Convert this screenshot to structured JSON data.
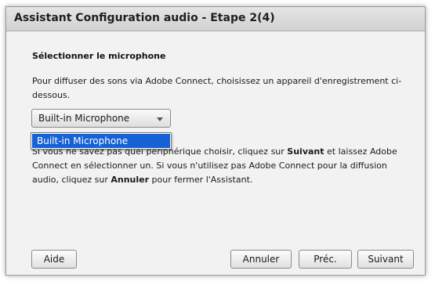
{
  "window": {
    "title": "Assistant Configuration audio - Etape 2(4)"
  },
  "content": {
    "heading": "Sélectionner le microphone",
    "description": "Pour diffuser des sons via Adobe Connect, choisissez un appareil d'enregistrement ci-dessous.",
    "microphone_select": {
      "selected": "Built-in Microphone",
      "options": [
        "Built-in Microphone"
      ]
    },
    "info": {
      "part1": "Si vous ne savez pas quel périphérique choisir, cliquez sur ",
      "suivant": "Suivant",
      "part2": " et laissez Adobe Connect en sélectionner un. Si vous n'utilisez pas Adobe Connect pour la diffusion audio, cliquez sur ",
      "annuler": "Annuler",
      "part3": " pour fermer l'Assistant."
    }
  },
  "buttons": {
    "aide": "Aide",
    "annuler": "Annuler",
    "prec": "Préc.",
    "suivant": "Suivant"
  },
  "colors": {
    "selection_highlight": "#1561d6",
    "window_background": "#f2f2f2",
    "titlebar": "#d8d8d8"
  }
}
